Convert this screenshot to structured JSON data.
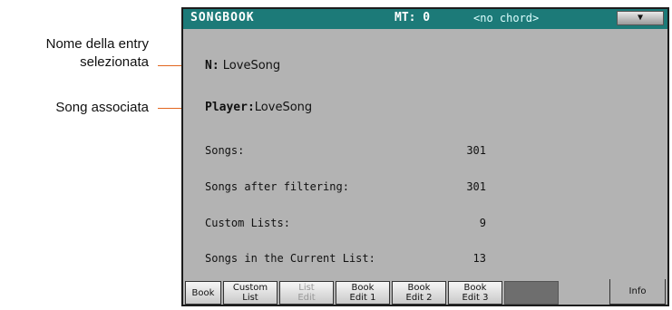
{
  "callouts": {
    "entry_name": "Nome della entry\nselezionata",
    "associated_song": "Song associata"
  },
  "header": {
    "title": "SONGBOOK",
    "mt": "MT: 0",
    "chord": "<no chord>",
    "menu_icon": "triangle-down-icon"
  },
  "entry": {
    "name_label": "N:",
    "name_value": "LoveSong",
    "player_label": "Player:",
    "player_value": "LoveSong"
  },
  "stats": [
    {
      "label": "Songs:",
      "value": "301"
    },
    {
      "label": "Songs after filtering:",
      "value": "301"
    },
    {
      "label": "Custom Lists:",
      "value": "9"
    },
    {
      "label": "Songs in the Current List:",
      "value": "13"
    }
  ],
  "tabs": [
    {
      "label": "Book",
      "state": "normal"
    },
    {
      "label": "Custom\nList",
      "state": "normal"
    },
    {
      "label": "List\nEdit",
      "state": "disabled"
    },
    {
      "label": "Book\nEdit 1",
      "state": "normal"
    },
    {
      "label": "Book\nEdit 2",
      "state": "normal"
    },
    {
      "label": "Book\nEdit 3",
      "state": "normal"
    },
    {
      "label": "",
      "state": "blank"
    },
    {
      "label": "Info",
      "state": "active"
    }
  ],
  "colors": {
    "header_bg": "#1c7a78",
    "panel_bg": "#b3b3b3",
    "leader": "#e2661f"
  }
}
